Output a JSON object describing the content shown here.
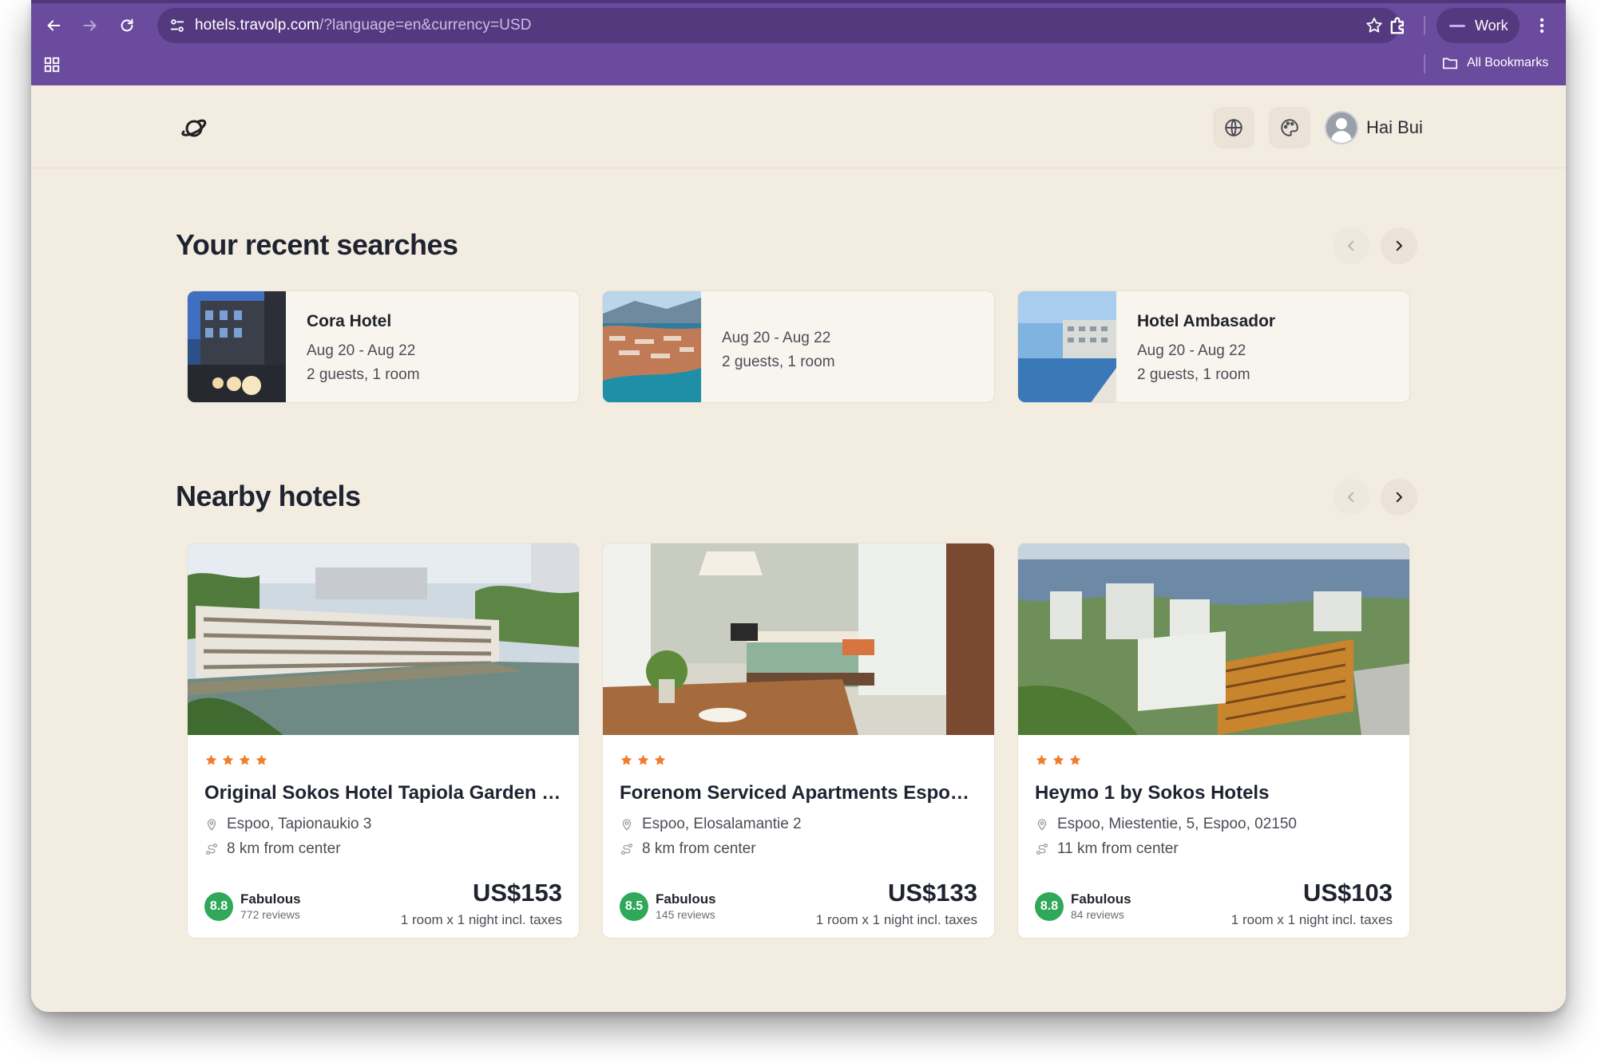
{
  "browser": {
    "url_host": "hotels.travolp.com",
    "url_rest": "/?language=en&currency=USD",
    "profile_label": "Work",
    "bookmarks_label": "All Bookmarks",
    "accent_color": "#6a4b9d"
  },
  "header": {
    "logo_icon": "planet-logo-icon",
    "language_icon": "globe-icon",
    "theme_icon": "palette-icon",
    "user_name": "Hai Bui"
  },
  "recent_searches": {
    "title": "Your recent searches",
    "items": [
      {
        "name": "Cora Hotel",
        "dates": "Aug 20 - Aug 22",
        "guests": "2 guests, 1 room"
      },
      {
        "name": "",
        "dates": "Aug 20 - Aug 22",
        "guests": "2 guests, 1 room"
      },
      {
        "name": "Hotel Ambasador",
        "dates": "Aug 20 - Aug 22",
        "guests": "2 guests, 1 room"
      }
    ]
  },
  "nearby_hotels": {
    "title": "Nearby hotels",
    "items": [
      {
        "stars": 4,
        "name": "Original Sokos Hotel Tapiola Garden Es...",
        "address": "Espoo, Tapionaukio 3",
        "distance": "8 km from center",
        "score": "8.8",
        "score_label": "Fabulous",
        "reviews": "772 reviews",
        "price": "US$153",
        "price_note": "1 room x 1 night incl. taxes"
      },
      {
        "stars": 3,
        "name": "Forenom Serviced Apartments Espoo ...",
        "address": "Espoo, Elosalamantie 2",
        "distance": "8 km from center",
        "score": "8.5",
        "score_label": "Fabulous",
        "reviews": "145 reviews",
        "price": "US$133",
        "price_note": "1 room x 1 night incl. taxes"
      },
      {
        "stars": 3,
        "name": "Heymo 1 by Sokos Hotels",
        "address": "Espoo, Miestentie, 5, Espoo, 02150",
        "distance": "11 km from center",
        "score": "8.8",
        "score_label": "Fabulous",
        "reviews": "84 reviews",
        "price": "US$103",
        "price_note": "1 room x 1 night incl. taxes"
      }
    ]
  },
  "colors": {
    "page_background": "#f3ece1",
    "star": "#f07e2c",
    "score_badge": "#2fa85a"
  }
}
